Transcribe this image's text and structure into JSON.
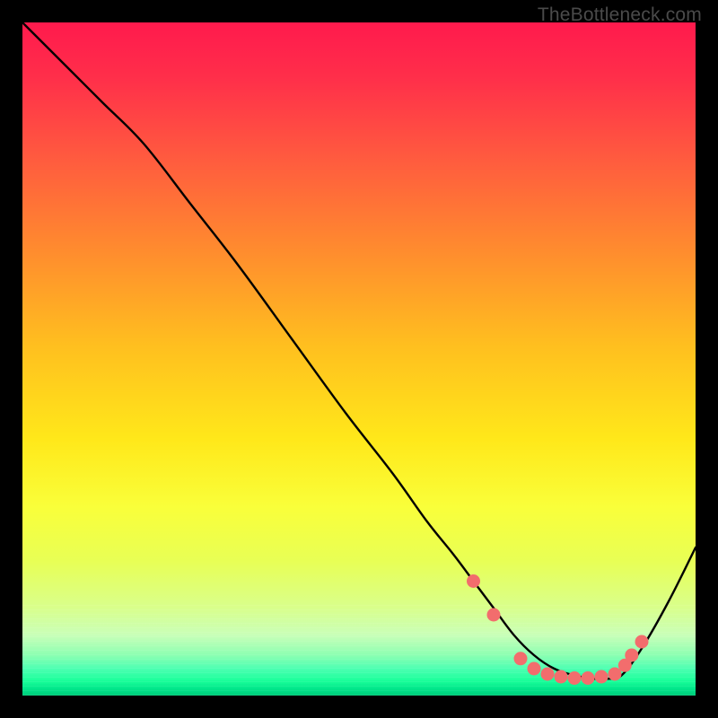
{
  "watermark": "TheBottleneck.com",
  "colors": {
    "frame": "#000000",
    "curve_stroke": "#000000",
    "dot_fill": "#f26d6d",
    "dot_stroke": "#c94f4f"
  },
  "chart_data": {
    "type": "line",
    "title": "",
    "xlabel": "",
    "ylabel": "",
    "xlim": [
      0,
      100
    ],
    "ylim": [
      0,
      100
    ],
    "grid": false,
    "series": [
      {
        "name": "curve",
        "x": [
          0,
          7,
          12,
          18,
          25,
          32,
          40,
          48,
          55,
          60,
          64,
          67,
          70,
          73,
          76,
          79,
          82,
          85,
          87,
          89,
          92,
          96,
          100
        ],
        "y": [
          100,
          93,
          88,
          82,
          73,
          64,
          53,
          42,
          33,
          26,
          21,
          17,
          13,
          9,
          6,
          4,
          3,
          2.5,
          2.5,
          3,
          7,
          14,
          22
        ]
      }
    ],
    "dots": [
      {
        "x": 67,
        "y": 17
      },
      {
        "x": 70,
        "y": 12
      },
      {
        "x": 74,
        "y": 5.5
      },
      {
        "x": 76,
        "y": 4
      },
      {
        "x": 78,
        "y": 3.2
      },
      {
        "x": 80,
        "y": 2.8
      },
      {
        "x": 82,
        "y": 2.6
      },
      {
        "x": 84,
        "y": 2.6
      },
      {
        "x": 86,
        "y": 2.8
      },
      {
        "x": 88,
        "y": 3.2
      },
      {
        "x": 89.5,
        "y": 4.5
      },
      {
        "x": 90.5,
        "y": 6
      },
      {
        "x": 92,
        "y": 8
      }
    ]
  }
}
